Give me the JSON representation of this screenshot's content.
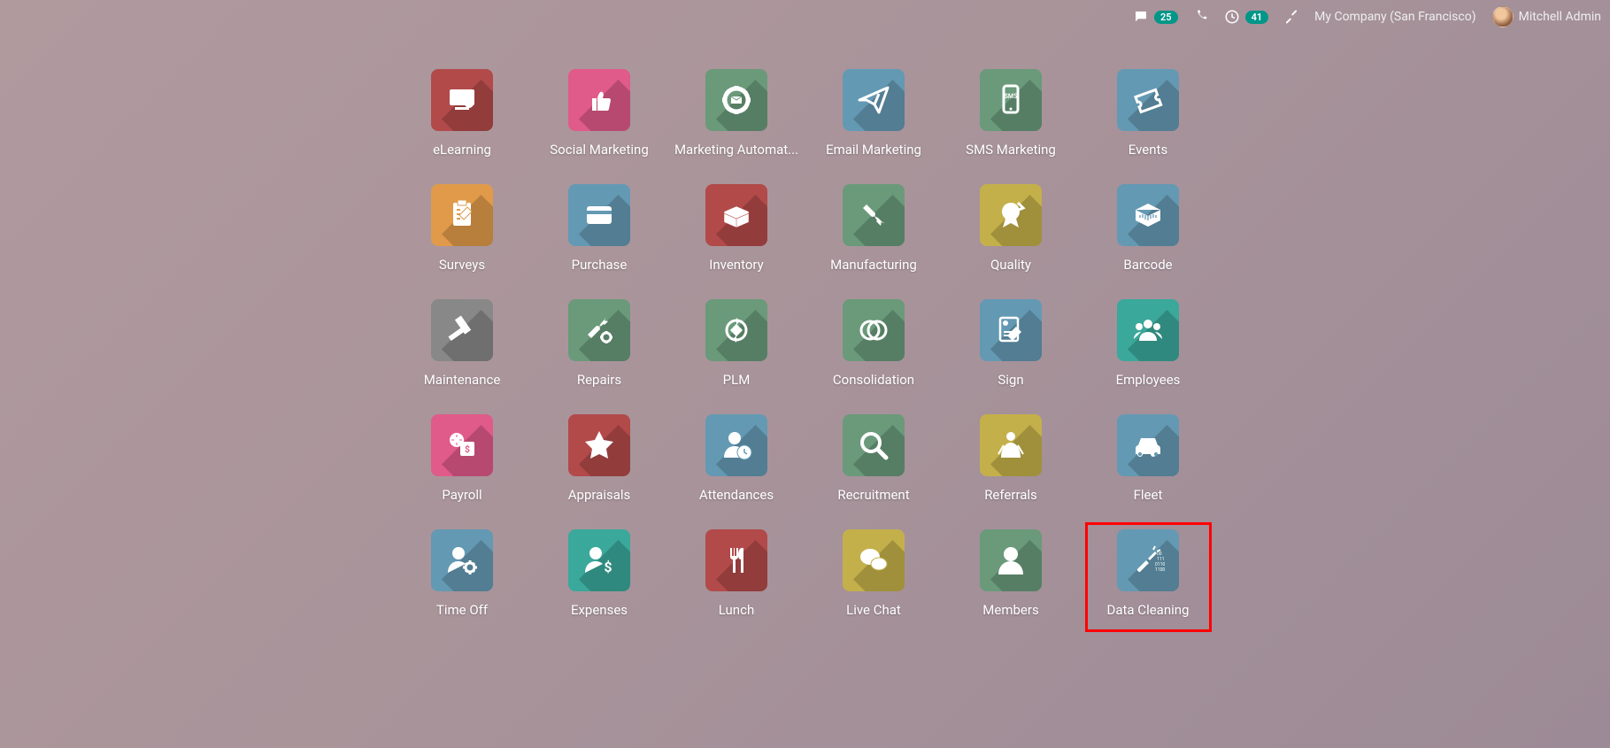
{
  "header": {
    "messages_count": "25",
    "calls_count": "41",
    "company": "My Company (San Francisco)",
    "user": "Mitchell Admin"
  },
  "apps": [
    {
      "label": "eLearning",
      "color": "#b24a4a",
      "icon": "elearning"
    },
    {
      "label": "Social Marketing",
      "color": "#e05a8a",
      "icon": "thumbs-up"
    },
    {
      "label": "Marketing Automat...",
      "color": "#6a9a7a",
      "icon": "gear-mail"
    },
    {
      "label": "Email Marketing",
      "color": "#6499b3",
      "icon": "paper-plane"
    },
    {
      "label": "SMS Marketing",
      "color": "#6a9a7a",
      "icon": "phone-sms"
    },
    {
      "label": "Events",
      "color": "#6499b3",
      "icon": "ticket"
    },
    {
      "label": "Surveys",
      "color": "#e09a4a",
      "icon": "clipboard"
    },
    {
      "label": "Purchase",
      "color": "#6499b3",
      "icon": "card"
    },
    {
      "label": "Inventory",
      "color": "#b24a4a",
      "icon": "box-open"
    },
    {
      "label": "Manufacturing",
      "color": "#6a9a7a",
      "icon": "wrench"
    },
    {
      "label": "Quality",
      "color": "#c4b04a",
      "icon": "medal"
    },
    {
      "label": "Barcode",
      "color": "#6499b3",
      "icon": "barcode-box"
    },
    {
      "label": "Maintenance",
      "color": "#888888",
      "icon": "hammer"
    },
    {
      "label": "Repairs",
      "color": "#6a9a7a",
      "icon": "wrench-gear"
    },
    {
      "label": "PLM",
      "color": "#6a9a7a",
      "icon": "cycle"
    },
    {
      "label": "Consolidation",
      "color": "#6a9a7a",
      "icon": "venn"
    },
    {
      "label": "Sign",
      "color": "#6499b3",
      "icon": "signature"
    },
    {
      "label": "Employees",
      "color": "#3aa89a",
      "icon": "group"
    },
    {
      "label": "Payroll",
      "color": "#e05a8a",
      "icon": "calendar-money"
    },
    {
      "label": "Appraisals",
      "color": "#b24a4a",
      "icon": "star"
    },
    {
      "label": "Attendances",
      "color": "#6499b3",
      "icon": "person-clock"
    },
    {
      "label": "Recruitment",
      "color": "#6a9a7a",
      "icon": "magnifier"
    },
    {
      "label": "Referrals",
      "color": "#c4b04a",
      "icon": "hero"
    },
    {
      "label": "Fleet",
      "color": "#6499b3",
      "icon": "car"
    },
    {
      "label": "Time Off",
      "color": "#6499b3",
      "icon": "person-gear"
    },
    {
      "label": "Expenses",
      "color": "#3aa89a",
      "icon": "person-money"
    },
    {
      "label": "Lunch",
      "color": "#b24a4a",
      "icon": "cutlery"
    },
    {
      "label": "Live Chat",
      "color": "#c4b04a",
      "icon": "chat"
    },
    {
      "label": "Members",
      "color": "#6a9a7a",
      "icon": "member"
    },
    {
      "label": "Data Cleaning",
      "color": "#6499b3",
      "icon": "broom-data",
      "highlighted": true
    }
  ]
}
